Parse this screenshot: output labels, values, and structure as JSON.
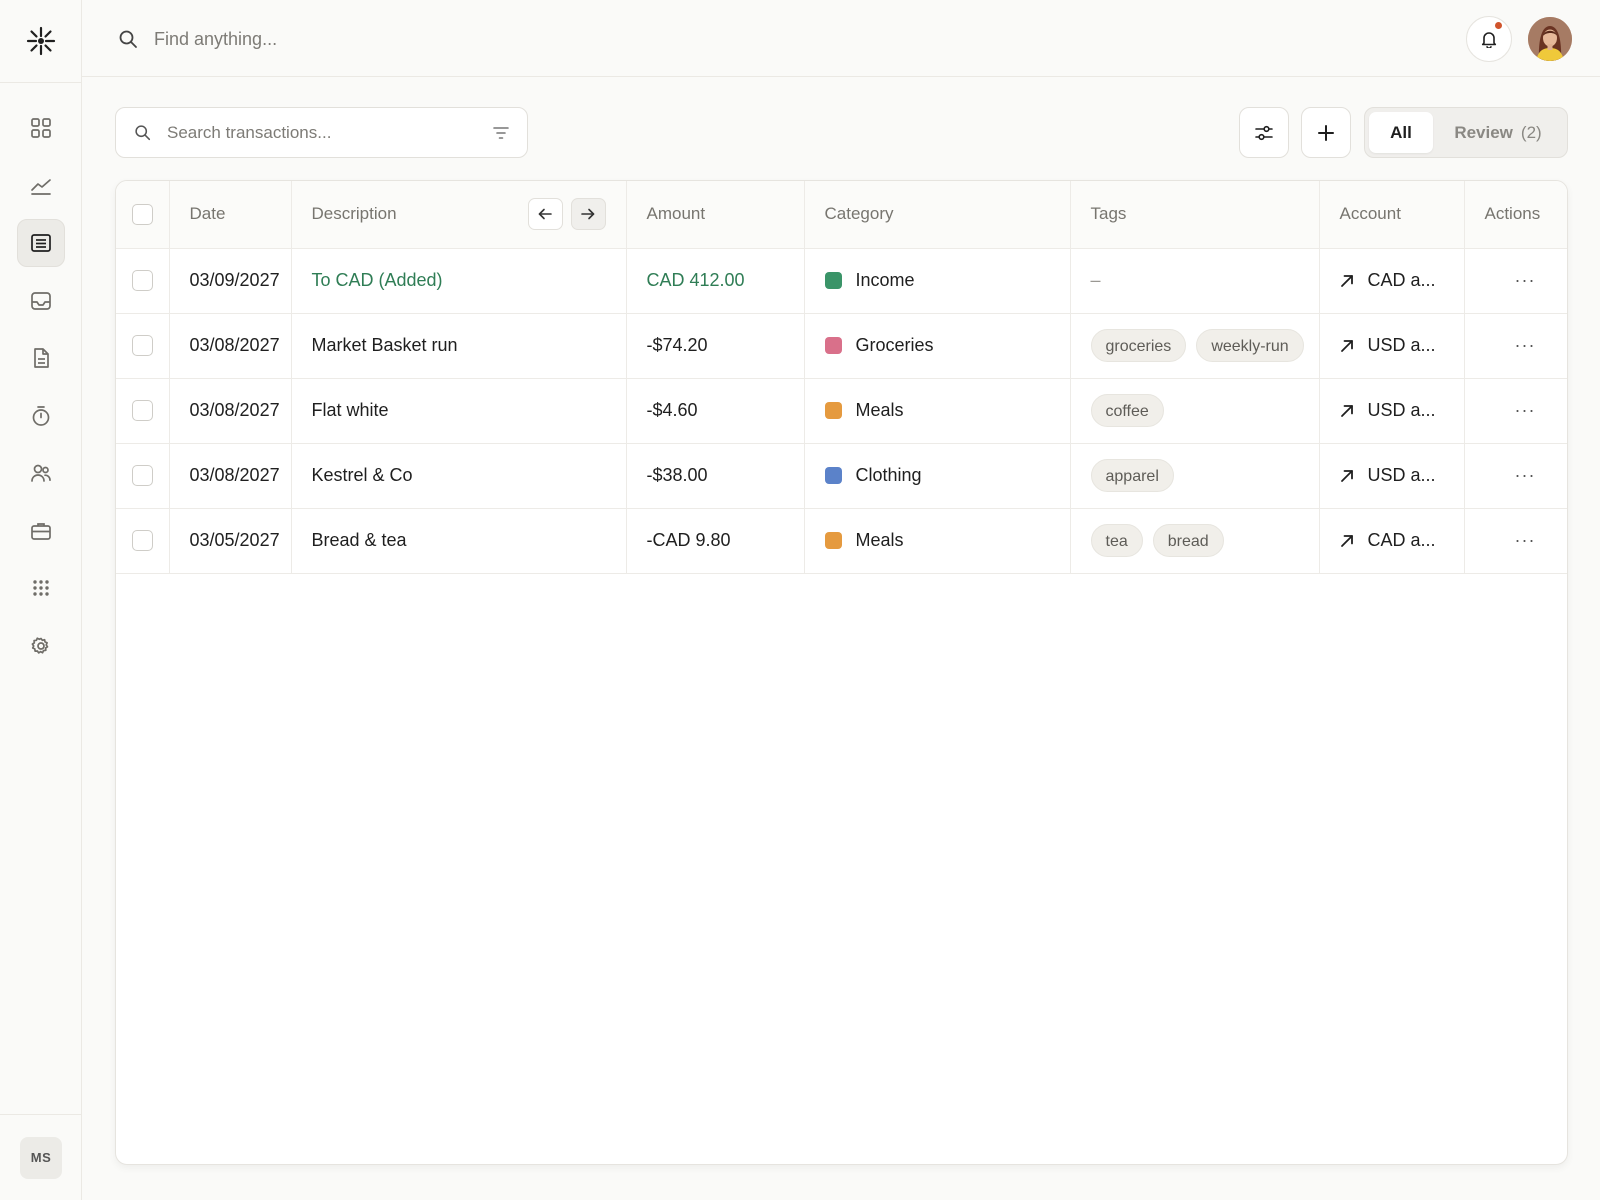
{
  "brand": {
    "logo_icon": "sparkle-icon"
  },
  "sidebar": {
    "items": [
      {
        "icon": "grid-icon",
        "active": false
      },
      {
        "icon": "chart-line-icon",
        "active": false
      },
      {
        "icon": "transactions-icon",
        "active": true
      },
      {
        "icon": "inbox-icon",
        "active": false
      },
      {
        "icon": "document-icon",
        "active": false
      },
      {
        "icon": "timer-icon",
        "active": false
      },
      {
        "icon": "users-icon",
        "active": false
      },
      {
        "icon": "briefcase-icon",
        "active": false
      },
      {
        "icon": "apps-icon",
        "active": false
      },
      {
        "icon": "gear-icon",
        "active": false
      }
    ],
    "user_initials": "MS"
  },
  "topbar": {
    "search_placeholder": "Find anything...",
    "notification_dot_color": "#d0542c"
  },
  "toolbar": {
    "search_placeholder": "Search transactions...",
    "filter_all_label": "All",
    "filter_review_label": "Review",
    "filter_review_count": "(2)"
  },
  "table": {
    "columns": {
      "date": "Date",
      "description": "Description",
      "amount": "Amount",
      "category": "Category",
      "tags": "Tags",
      "account": "Account",
      "actions": "Actions"
    },
    "rows": [
      {
        "date": "03/09/2027",
        "description": "To CAD (Added)",
        "amount": "CAD 412.00",
        "category": "Income",
        "category_color": "#3a9468",
        "tags": [],
        "empty_tags": "–",
        "account": "CAD a...",
        "actions": "···",
        "highlight": true
      },
      {
        "date": "03/08/2027",
        "description": "Market Basket run",
        "amount": "-$74.20",
        "category": "Groceries",
        "category_color": "#d9708a",
        "tags": [
          "groceries",
          "weekly-run"
        ],
        "empty_tags": "",
        "account": "USD a...",
        "actions": "···",
        "highlight": false
      },
      {
        "date": "03/08/2027",
        "description": "Flat white",
        "amount": "-$4.60",
        "category": "Meals",
        "category_color": "#e59a3f",
        "tags": [
          "coffee"
        ],
        "empty_tags": "",
        "account": "USD a...",
        "actions": "···",
        "highlight": false
      },
      {
        "date": "03/08/2027",
        "description": "Kestrel & Co",
        "amount": "-$38.00",
        "category": "Clothing",
        "category_color": "#5b82c9",
        "tags": [
          "apparel"
        ],
        "empty_tags": "",
        "account": "USD a...",
        "actions": "···",
        "highlight": false
      },
      {
        "date": "03/05/2027",
        "description": "Bread & tea",
        "amount": "-CAD 9.80",
        "category": "Meals",
        "category_color": "#e59a3f",
        "tags": [
          "tea",
          "bread"
        ],
        "empty_tags": "",
        "account": "CAD a...",
        "actions": "···",
        "highlight": false
      }
    ]
  }
}
